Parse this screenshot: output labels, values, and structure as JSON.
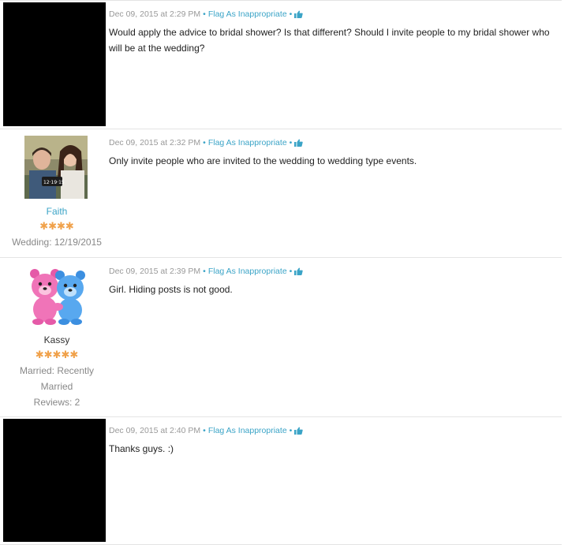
{
  "flag_label": "Flag As Inappropriate",
  "separator": "•",
  "thumb_icon": "thumbs-up-icon",
  "colors": {
    "link": "#3ba4c7",
    "star": "#f0a14a",
    "meta": "#999999"
  },
  "posts": [
    {
      "timestamp": "Dec 09, 2015 at 2:29 PM",
      "body": "Would apply the advice to bridal shower? Is that different? Should I invite people to my bridal shower who will be at the wedding?"
    },
    {
      "timestamp": "Dec 09, 2015 at 2:32 PM",
      "body": "Only invite people who are invited to the wedding to wedding type events.",
      "user": {
        "name": "Faith",
        "stars": "✱✱✱✱",
        "rating": 4,
        "wedding": "Wedding: 12/19/2015"
      }
    },
    {
      "timestamp": "Dec 09, 2015 at 2:39 PM",
      "body": "Girl. Hiding posts is not good.",
      "user": {
        "name": "Kassy",
        "stars": "✱✱✱✱✱",
        "rating": 5,
        "married_line1": "Married: Recently",
        "married_line2": "Married",
        "reviews": "Reviews: 2"
      }
    },
    {
      "timestamp": "Dec 09, 2015 at 2:40 PM",
      "body": "Thanks guys. :)"
    }
  ]
}
